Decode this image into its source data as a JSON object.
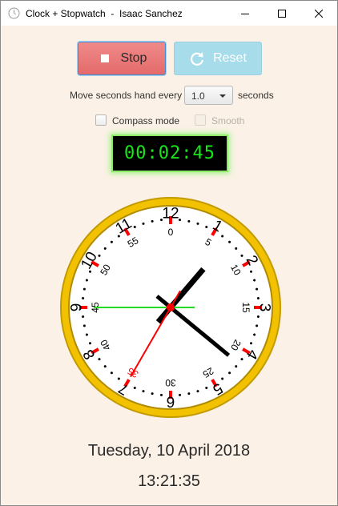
{
  "window": {
    "title": "Clock + Stopwatch  -  Isaac Sanchez",
    "icon": "clock-app-icon",
    "controls": [
      "minimize-icon",
      "maximize-icon",
      "close-icon"
    ]
  },
  "toolbar": {
    "stop_label": "Stop",
    "stop_icon": "stop-icon",
    "reset_label": "Reset",
    "reset_icon": "refresh-icon",
    "reset_enabled": false
  },
  "settings": {
    "move_label": "Move seconds hand every",
    "interval_value": "1.0",
    "seconds_label": "seconds",
    "compass_label": "Compass mode",
    "compass_checked": false,
    "smooth_label": "Smooth",
    "smooth_checked": false,
    "smooth_enabled": false
  },
  "stopwatch": {
    "display": "00:02:45",
    "elapsed_seconds": 165
  },
  "clock": {
    "hour_numerals": [
      "12",
      "1",
      "2",
      "3",
      "4",
      "5",
      "6",
      "7",
      "8",
      "9",
      "10",
      "11"
    ],
    "stopwatch_numerals": [
      "0",
      "5",
      "10",
      "15",
      "20",
      "25",
      "30",
      "35",
      "40",
      "45",
      "50",
      "55"
    ],
    "hour": 13,
    "minute": 21,
    "second": 35,
    "colors": {
      "rim": "#f2c200",
      "face": "#ffffff",
      "hour_minute_hands": "#000000",
      "second_hand": "#ff0000",
      "stopwatch_hand": "#22dd22",
      "hour_marks": "#ff0000"
    }
  },
  "footer": {
    "date": "Tuesday, 10 April 2018",
    "time": "13:21:35"
  }
}
